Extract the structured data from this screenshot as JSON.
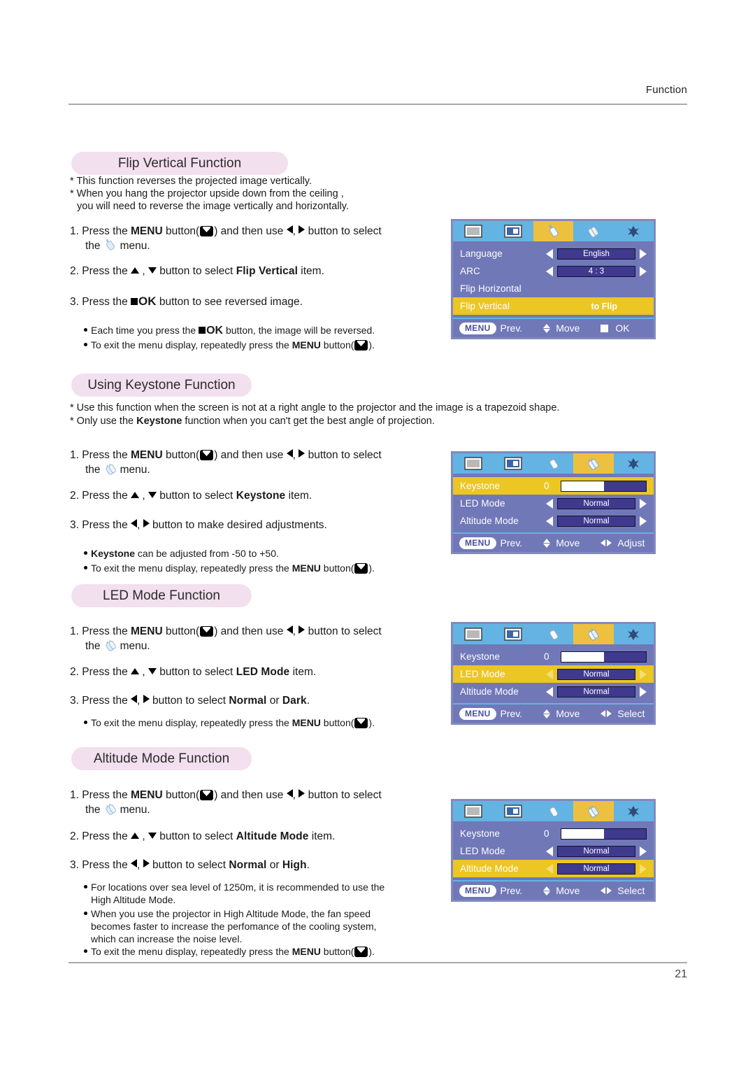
{
  "page": {
    "header_label": "Function",
    "page_number": "21"
  },
  "sections": [
    {
      "heading": "Flip Vertical Function",
      "notes": [
        "* This function reverses the projected image vertically.",
        "* When you hang the projector upside down from the ceiling ,",
        "you will need to reverse  the image vertically and horizontally."
      ],
      "steps": {
        "s1a": "1. Press the ",
        "s1_menu": "MENU",
        "s1b": " button(",
        "s1c": ") and then use ",
        "s1d": ", ",
        "s1e": " button to select",
        "s1f": "the",
        "s1g": "menu.",
        "s2a": "2. Press the ",
        "s2b": " , ",
        "s2c": " button to select ",
        "s2_item": "Flip Vertical",
        "s2d": " item.",
        "s3a": "3. Press the ",
        "s3_ok": "OK",
        "s3b": " button to see reversed image."
      },
      "bullets": {
        "b1a": "Each time you press the ",
        "b1_ok": "OK",
        "b1b": " button, the image will be reversed.",
        "b2a": "To exit the menu display, repeatedly press the ",
        "b2_menu": "MENU",
        "b2b": " button(",
        "b2c": ")."
      }
    },
    {
      "heading": "Using Keystone Function",
      "notes": [
        "* Use this function when the screen is not at a right angle to the projector and the image is a trapezoid shape.",
        "* Only use the Keystone function when you can't get the best angle of projection."
      ],
      "note2": {
        "a": "* Only use the ",
        "bold": "Keystone",
        "b": " function when you can't get the best angle of projection."
      },
      "steps": {
        "s1a": "1. Press the ",
        "s1_menu": "MENU",
        "s1b": " button(",
        "s1c": ") and then use ",
        "s1d": ", ",
        "s1e": " button to select",
        "s1f": "the",
        "s1g": "menu.",
        "s2a": "2. Press the ",
        "s2b": " , ",
        "s2c": " button to select ",
        "s2_item": "Keystone",
        "s2d": " item.",
        "s3a": "3. Press the ",
        "s3b": ", ",
        "s3c": " button to make desired adjustments."
      },
      "bullets": {
        "b1_item": "Keystone",
        "b1a": " can be adjusted from -50 to +50.",
        "b2a": "To exit the menu display, repeatedly press the ",
        "b2_menu": "MENU",
        "b2b": " button(",
        "b2c": ")."
      }
    },
    {
      "heading": "LED Mode Function",
      "steps": {
        "s1a": "1. Press the ",
        "s1_menu": "MENU",
        "s1b": " button(",
        "s1c": ") and then use ",
        "s1d": ", ",
        "s1e": " button to select",
        "s1f": "the",
        "s1g": "menu.",
        "s2a": "2. Press the ",
        "s2b": " , ",
        "s2c": " button to select ",
        "s2_item": "LED Mode",
        "s2d": " item.",
        "s3a": "3. Press the ",
        "s3b": ", ",
        "s3c": " button to select ",
        "s3_opt1": "Normal",
        "s3_or": " or ",
        "s3_opt2": "Dark",
        "s3d": "."
      },
      "bullets": {
        "b2a": "To exit the menu display, repeatedly press the ",
        "b2_menu": "MENU",
        "b2b": " button(",
        "b2c": ")."
      }
    },
    {
      "heading": "Altitude Mode Function",
      "steps": {
        "s1a": "1. Press the ",
        "s1_menu": "MENU",
        "s1b": " button(",
        "s1c": ") and then use ",
        "s1d": ", ",
        "s1e": " button to select",
        "s1f": "the",
        "s1g": "menu.",
        "s2a": "2. Press the ",
        "s2b": " , ",
        "s2c": " button to select ",
        "s2_item": "Altitude Mode",
        "s2d": " item.",
        "s3a": "3. Press the ",
        "s3b": ", ",
        "s3c": " button to select ",
        "s3_opt1": "Normal",
        "s3_or": " or ",
        "s3_opt2": "High",
        "s3d": "."
      },
      "bullets": {
        "b1l1": "For locations over sea level of 1250m, it is recommended to use the",
        "b1l2": "High Altitude Mode.",
        "b2l1": "When you use the projector in High Altitude Mode, the fan speed",
        "b2l2": "becomes faster to increase the perfomance of the cooling system,",
        "b2l3": "which can increase the noise level.",
        "b3a": "To exit the menu display, repeatedly press the ",
        "b3_menu": "MENU",
        "b3b": " button(",
        "b3c": ")."
      }
    }
  ],
  "osd": {
    "colors": {
      "tab_bar": "#63b4e3",
      "tab_active": "#edc13f",
      "body": "#7078b8",
      "row_highlight": "#ecc623",
      "chip": "#3f3a8e",
      "frame": "#8289bf"
    },
    "menu1": {
      "rows": [
        {
          "label": "Language",
          "value": "English",
          "kind": "chip",
          "highlight": false
        },
        {
          "label": "ARC",
          "value": "4 : 3",
          "kind": "chip",
          "highlight": false
        },
        {
          "label": "Flip Horizontal",
          "value": "",
          "kind": "none",
          "highlight": false
        },
        {
          "label": "Flip Vertical",
          "value": "to Flip",
          "kind": "text",
          "highlight": true
        }
      ],
      "footer": {
        "menu": "MENU",
        "prev": "Prev.",
        "move": "Move",
        "action": "OK"
      },
      "active_tab": 2
    },
    "menu2": {
      "rows": [
        {
          "label": "Keystone",
          "value": "0",
          "kind": "slider",
          "fill": 50,
          "highlight": true
        },
        {
          "label": "LED Mode",
          "value": "Normal",
          "kind": "chip",
          "highlight": false
        },
        {
          "label": "Altitude Mode",
          "value": "Normal",
          "kind": "chip",
          "highlight": false
        }
      ],
      "footer": {
        "menu": "MENU",
        "prev": "Prev.",
        "move": "Move",
        "action": "Adjust"
      },
      "active_tab": 3
    },
    "menu3": {
      "rows": [
        {
          "label": "Keystone",
          "value": "0",
          "kind": "slider",
          "fill": 50,
          "highlight": false
        },
        {
          "label": "LED Mode",
          "value": "Normal",
          "kind": "chip",
          "highlight": true
        },
        {
          "label": "Altitude Mode",
          "value": "Normal",
          "kind": "chip",
          "highlight": false
        }
      ],
      "footer": {
        "menu": "MENU",
        "prev": "Prev.",
        "move": "Move",
        "action": "Select"
      },
      "active_tab": 3
    },
    "menu4": {
      "rows": [
        {
          "label": "Keystone",
          "value": "0",
          "kind": "slider",
          "fill": 50,
          "highlight": false
        },
        {
          "label": "LED Mode",
          "value": "Normal",
          "kind": "chip",
          "highlight": false
        },
        {
          "label": "Altitude Mode",
          "value": "Normal",
          "kind": "chip",
          "highlight": true
        }
      ],
      "footer": {
        "menu": "MENU",
        "prev": "Prev.",
        "move": "Move",
        "action": "Select"
      },
      "active_tab": 3
    },
    "tab_icons": [
      "screen-icon",
      "pip-screen-icon",
      "roller-single-icon",
      "roller-double-icon",
      "tool-icon"
    ]
  }
}
